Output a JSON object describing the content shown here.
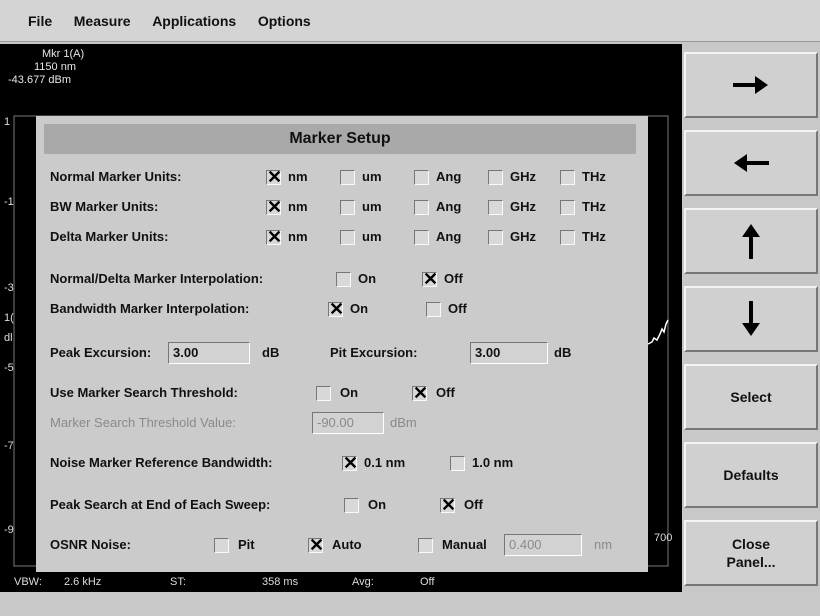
{
  "menubar": {
    "items": [
      "File",
      "Measure",
      "Applications",
      "Options"
    ]
  },
  "marker_readout": {
    "line1": "Mkr 1(A)",
    "line2": "1150 nm",
    "line3": "-43.677 dBm"
  },
  "y_ticks": [
    "1",
    "-1",
    "-3",
    "1(",
    "dl",
    "-5",
    "-7",
    "-9"
  ],
  "right_tick": "700",
  "status": {
    "vbw_label": "VBW:",
    "vbw_value": "2.6 kHz",
    "st_label": "ST:",
    "st_value": "358 ms",
    "avg_label": "Avg:",
    "avg_value": "Off"
  },
  "softkeys": [
    {
      "icon": "arrow-right"
    },
    {
      "icon": "arrow-left"
    },
    {
      "icon": "arrow-up"
    },
    {
      "icon": "arrow-down"
    },
    {
      "label": "Select"
    },
    {
      "label": "Defaults"
    },
    {
      "label": "Close\nPanel..."
    }
  ],
  "dialog": {
    "title": "Marker Setup",
    "unit_rows": [
      {
        "label": "Normal Marker Units:",
        "checked": "nm"
      },
      {
        "label": "BW Marker Units:",
        "checked": "nm"
      },
      {
        "label": "Delta Marker Units:",
        "checked": "nm"
      }
    ],
    "unit_options": [
      "nm",
      "um",
      "Ang",
      "GHz",
      "THz"
    ],
    "interp_normal": {
      "label": "Normal/Delta Marker Interpolation:",
      "on": "On",
      "off": "Off",
      "checked": "off"
    },
    "interp_bw": {
      "label": "Bandwidth Marker Interpolation:",
      "on": "On",
      "off": "Off",
      "checked": "on"
    },
    "peak_excursion": {
      "label": "Peak Excursion:",
      "value": "3.00",
      "unit": "dB"
    },
    "pit_excursion": {
      "label": "Pit Excursion:",
      "value": "3.00",
      "unit": "dB"
    },
    "search_threshold": {
      "label": "Use Marker Search Threshold:",
      "on": "On",
      "off": "Off",
      "checked": "off"
    },
    "threshold_value": {
      "label": "Marker Search Threshold Value:",
      "value": "-90.00",
      "unit": "dBm"
    },
    "noise_bw": {
      "label": "Noise Marker Reference Bandwidth:",
      "opt1": "0.1 nm",
      "opt2": "1.0 nm",
      "checked": "opt1"
    },
    "peak_search": {
      "label": "Peak Search at End of Each Sweep:",
      "on": "On",
      "off": "Off",
      "checked": "off"
    },
    "osnr": {
      "label": "OSNR Noise:",
      "pit": "Pit",
      "auto": "Auto",
      "manual": "Manual",
      "manual_value": "0.400",
      "manual_unit": "nm",
      "checked": "auto"
    }
  }
}
